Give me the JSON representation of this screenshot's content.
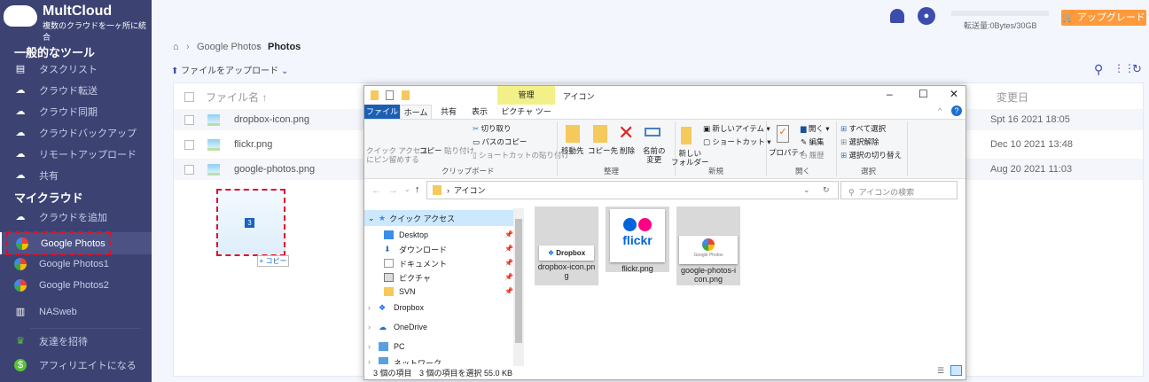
{
  "app": {
    "name": "MultCloud",
    "tagline": "複数のクラウドを一ヶ所に統合"
  },
  "sidebar": {
    "section_tools": "一般的なツール",
    "tools": [
      {
        "label": "タスクリスト",
        "icon": "clipboard-icon"
      },
      {
        "label": "クラウド転送",
        "icon": "cloud-transfer-icon"
      },
      {
        "label": "クラウド同期",
        "icon": "cloud-sync-icon"
      },
      {
        "label": "クラウドバックアップ",
        "icon": "cloud-backup-icon"
      },
      {
        "label": "リモートアップロード",
        "icon": "cloud-upload-icon"
      },
      {
        "label": "共有",
        "icon": "share-icon"
      }
    ],
    "section_clouds": "マイクラウド",
    "add_cloud": "クラウドを追加",
    "clouds": [
      {
        "label": "Google Photos",
        "active": true
      },
      {
        "label": "Google Photos1"
      },
      {
        "label": "Google Photos2"
      }
    ],
    "nasweb": "NASweb",
    "invite": "友達を招待",
    "affiliate": "アフィリエイトになる"
  },
  "header": {
    "quota": "転送量:0Bytes/30GB",
    "upgrade": "アップグレード"
  },
  "breadcrumb": {
    "items": [
      "Google Photos",
      "Photos"
    ]
  },
  "toolbar": {
    "upload": "ファイルをアップロード"
  },
  "table": {
    "col_name": "ファイル名",
    "col_date": "変更日",
    "rows": [
      {
        "name": "dropbox-icon.png",
        "date": "Spt 16 2021 18:05"
      },
      {
        "name": "flickr.png",
        "date": "Dec 10 2021 13:48"
      },
      {
        "name": "google-photos.png",
        "date": "Aug 20 2021 11:03"
      }
    ]
  },
  "drag": {
    "count": "3",
    "action": "+ コピー"
  },
  "explorer": {
    "title": "アイコン",
    "manage_tab": "管理",
    "tabs": [
      "ファイル",
      "ホーム",
      "共有",
      "表示",
      "ピクチャ ツール"
    ],
    "ribbon": {
      "pin": "クイック アクセス\nにピン留めする",
      "copy": "コピー",
      "paste": "貼り付け",
      "cut": "切り取り",
      "copy_path": "パスのコピー",
      "paste_shortcut": "ショートカットの貼り付け",
      "clipboard": "クリップボード",
      "move_to": "移動先",
      "copy_to": "コピー先",
      "delete": "削除",
      "rename": "名前の\n変更",
      "organize": "整理",
      "new_folder": "新しい\nフォルダー",
      "new_item": "新しいアイテム ▾",
      "shortcut": "ショートカット ▾",
      "new": "新規",
      "properties": "プロパティ",
      "open": "開く ▾",
      "edit": "編集",
      "history": "履歴",
      "open_group": "開く",
      "select_all": "すべて選択",
      "select_none": "選択解除",
      "invert": "選択の切り替え",
      "select": "選択"
    },
    "address": "アイコン",
    "search_placeholder": "アイコンの検索",
    "nav": [
      {
        "label": "クイック アクセス"
      },
      {
        "label": "Desktop"
      },
      {
        "label": "ダウンロード"
      },
      {
        "label": "ドキュメント"
      },
      {
        "label": "ピクチャ"
      },
      {
        "label": "SVN"
      },
      {
        "label": "Dropbox"
      },
      {
        "label": "OneDrive"
      },
      {
        "label": "PC"
      },
      {
        "label": "ネットワーク"
      }
    ],
    "files": [
      {
        "name": "dropbox-icon.png",
        "logo": "Dropbox"
      },
      {
        "name": "flickr.png",
        "logo": "flickr"
      },
      {
        "name": "google-photos-icon.png",
        "logo": "Google Photos"
      }
    ],
    "status_count": "3 個の項目",
    "status_selected": "3 個の項目を選択  55.0 KB"
  }
}
